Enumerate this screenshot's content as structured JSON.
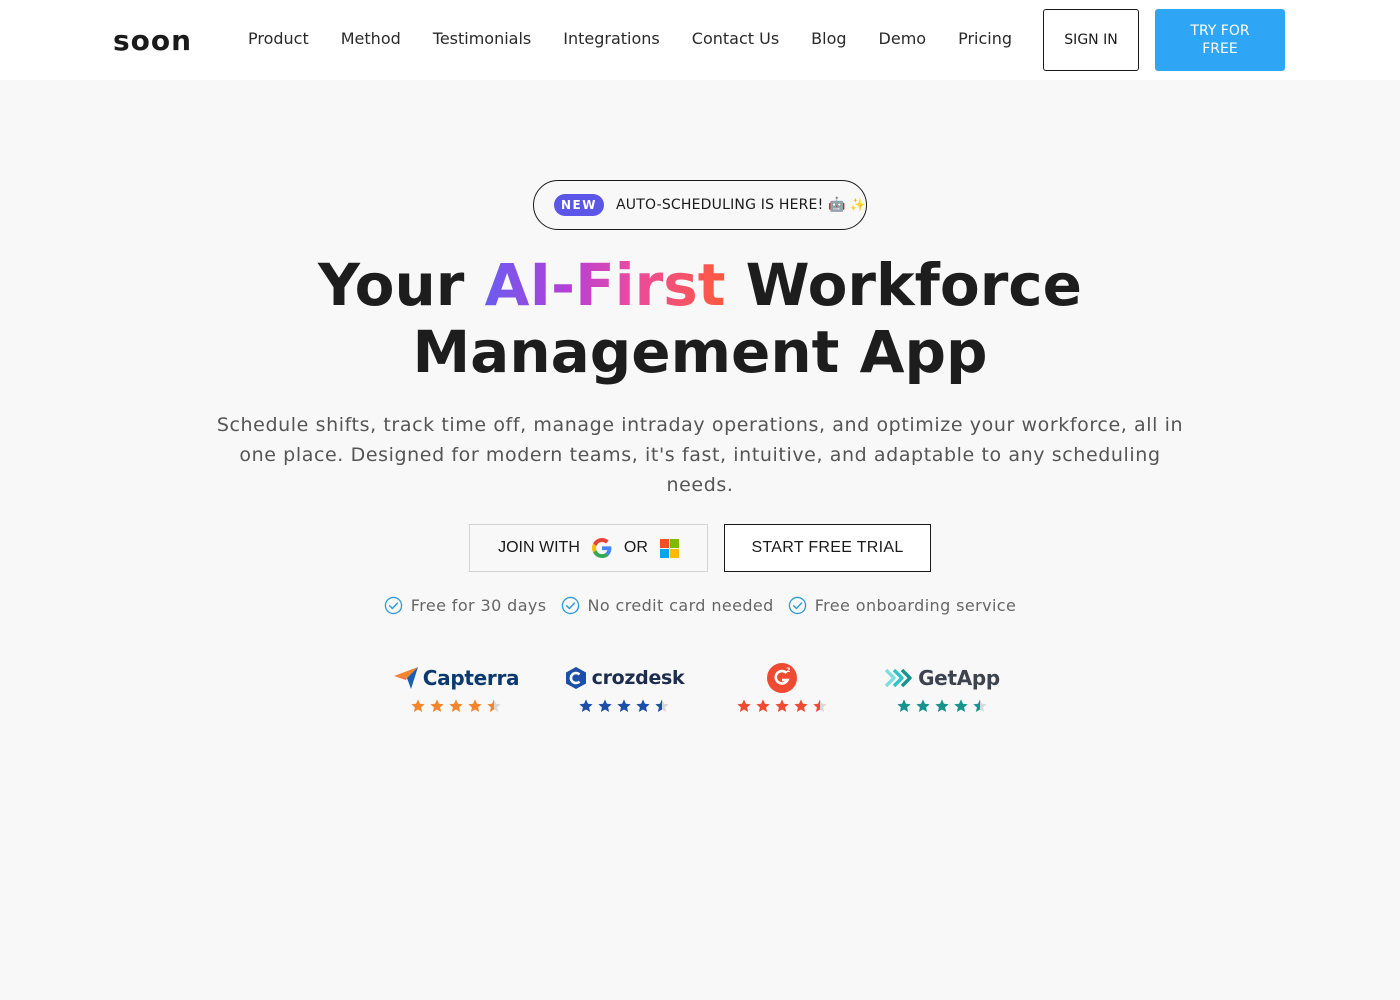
{
  "header": {
    "logo": "soon",
    "nav": [
      "Product",
      "Method",
      "Testimonials",
      "Integrations",
      "Contact Us",
      "Blog",
      "Demo",
      "Pricing"
    ],
    "signin_label": "SIGN IN",
    "try_label": "TRY FOR FREE"
  },
  "announcement": {
    "badge": "NEW",
    "text": "AUTO-SCHEDULING IS HERE! 🤖"
  },
  "hero": {
    "title_before": "Your ",
    "title_highlight": "AI-First",
    "title_after": " Workforce",
    "title_line2": "Management App",
    "subtitle": "Schedule shifts, track time off, manage intraday operations, and optimize your workforce, all in one place. Designed for modern teams, it's fast, intuitive, and adaptable to any scheduling needs."
  },
  "cta": {
    "join_prefix": "JOIN WITH",
    "join_or": "OR",
    "start_trial": "START FREE TRIAL"
  },
  "features": [
    "Free for 30 days",
    "No credit card needed",
    "Free onboarding service"
  ],
  "reviews": [
    {
      "brand": "Capterra",
      "rating": 4.5,
      "color": "#f5852a",
      "text_color": "#0d3a6e"
    },
    {
      "brand": "crozdesk",
      "rating": 4.5,
      "color": "#1d4fa8",
      "text_color": "#1d2d4f"
    },
    {
      "brand": "",
      "rating": 4.5,
      "color": "#ef4b32",
      "text_color": "#ef4b32"
    },
    {
      "brand": "GetApp",
      "rating": 4.5,
      "color": "#17938e",
      "text_color": "#3d4450"
    }
  ],
  "colors": {
    "accent_blue": "#2ea5f5",
    "badge_purple": "#5b55e8",
    "check_teal": "#2e9bd6"
  }
}
